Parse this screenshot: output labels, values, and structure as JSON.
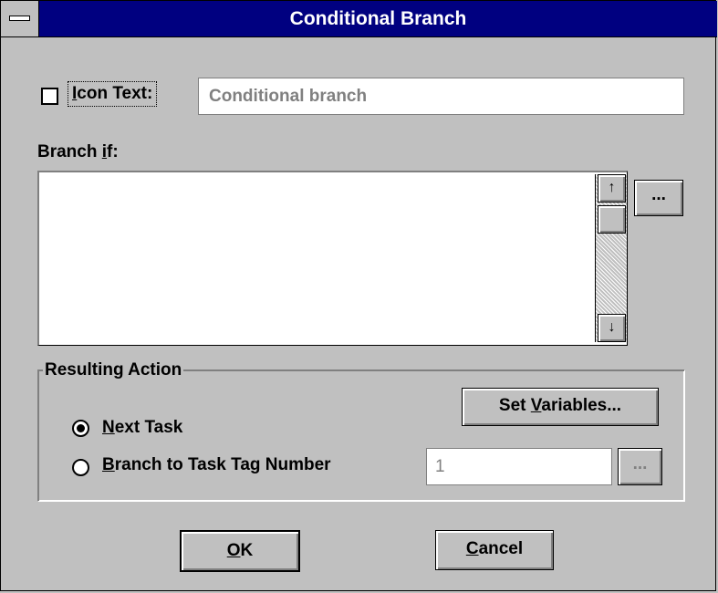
{
  "window": {
    "title": "Conditional Branch"
  },
  "icon_text": {
    "label_prefix": "",
    "label_mnemonic": "I",
    "label_rest": "con Text:",
    "value": "Conditional branch",
    "checked": false
  },
  "branch_if": {
    "label_prefix": "Branch ",
    "label_mnemonic": "i",
    "label_rest": "f:",
    "browse_label": "...",
    "scroll_up_glyph": "↑",
    "scroll_down_glyph": "↓"
  },
  "resulting_action": {
    "group_title": "Resulting Action",
    "set_variables": {
      "prefix": "Set ",
      "mnemonic": "V",
      "rest": "ariables..."
    },
    "next_task": {
      "mnemonic": "N",
      "rest": "ext Task",
      "selected": true
    },
    "branch_to_tag": {
      "mnemonic": "B",
      "rest": "ranch to Task Tag Number",
      "selected": false,
      "value": "1",
      "browse_label": "..."
    }
  },
  "buttons": {
    "ok": {
      "mnemonic": "O",
      "rest": "K"
    },
    "cancel": {
      "mnemonic": "C",
      "rest": "ancel"
    }
  }
}
